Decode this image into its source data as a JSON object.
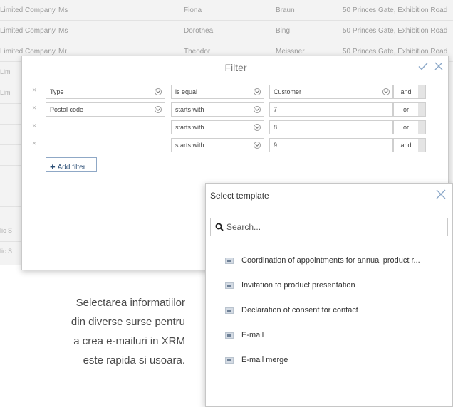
{
  "background_rows": [
    {
      "company": "Limited Company",
      "salutation": "Ms",
      "first_name": "Fiona",
      "last_name": "Braun",
      "address": "50 Princes Gate, Exhibition Road"
    },
    {
      "company": "Limited Company",
      "salutation": "Ms",
      "first_name": "Dorothea",
      "last_name": "Bing",
      "address": "50 Princes Gate, Exhibition Road"
    },
    {
      "company": "Limited Company",
      "salutation": "Mr",
      "first_name": "Theodor",
      "last_name": "Meissner",
      "address": "50 Princes Gate, Exhibition Road"
    }
  ],
  "background_edge_texts": [
    "Limi",
    "Limi",
    "lic S",
    "lic S"
  ],
  "filter": {
    "title": "Filter",
    "ok_icon": "checkmark-icon",
    "close_icon": "close-icon",
    "rows": [
      {
        "field": "Type",
        "operator": "is equal",
        "value": "Customer",
        "logic": "and"
      },
      {
        "field": "Postal code",
        "operator": "starts with",
        "value": "7",
        "logic": "or"
      },
      {
        "field": "",
        "operator": "starts with",
        "value": "8",
        "logic": "or"
      },
      {
        "field": "",
        "operator": "starts with",
        "value": "9",
        "logic": "and"
      }
    ],
    "remove_glyph": "×",
    "add_filter_label": "Add filter"
  },
  "template_panel": {
    "title": "Select template",
    "search_placeholder": "Search...",
    "items": [
      "Coordination of appointments for annual product r...",
      "Invitation to product presentation",
      "Declaration of consent for contact",
      "E-mail",
      "E-mail merge"
    ]
  },
  "caption": {
    "lines": [
      "Selectarea informatiilor",
      "din diverse surse pentru",
      "a crea e-mailuri in XRM",
      "este rapida si usoara."
    ]
  },
  "colors": {
    "accent": "#8aa7c8",
    "button_text": "#2a4d75"
  }
}
